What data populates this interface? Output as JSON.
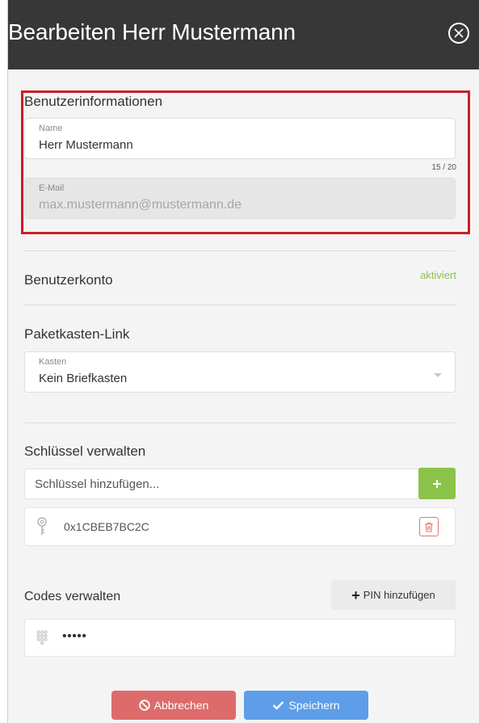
{
  "header": {
    "title": "Bearbeiten Herr Mustermann"
  },
  "user_info": {
    "title": "Benutzerinformationen",
    "name_label": "Name",
    "name_value": "Herr Mustermann",
    "name_counter": "15 / 20",
    "email_label": "E-Mail",
    "email_value": "max.mustermann@mustermann.de"
  },
  "account": {
    "title": "Benutzerkonto",
    "status": "aktiviert"
  },
  "mailbox": {
    "title": "Paketkasten-Link",
    "label": "Kasten",
    "value": "Kein Briefkasten"
  },
  "keys": {
    "title": "Schlüssel verwalten",
    "placeholder": "Schlüssel hinzufügen...",
    "add_label": "+",
    "items": [
      {
        "value": "0x1CBEB7BC2C"
      }
    ]
  },
  "codes": {
    "title": "Codes verwalten",
    "add_pin_label": "PIN hinzufügen",
    "items": [
      {
        "value": "•••••"
      }
    ]
  },
  "actions": {
    "cancel_label": "Abbrechen",
    "save_label": "Speichern"
  },
  "colors": {
    "header_bg": "#373737",
    "accent_green": "#8bc34a",
    "cancel_red": "#de6b6b",
    "save_blue": "#5e9de8",
    "highlight_red": "#c81e28"
  },
  "icons": [
    "close-circle-icon",
    "plus-icon",
    "key-icon",
    "trash-icon",
    "keypad-icon",
    "ban-icon",
    "check-icon",
    "chevron-down-icon"
  ]
}
